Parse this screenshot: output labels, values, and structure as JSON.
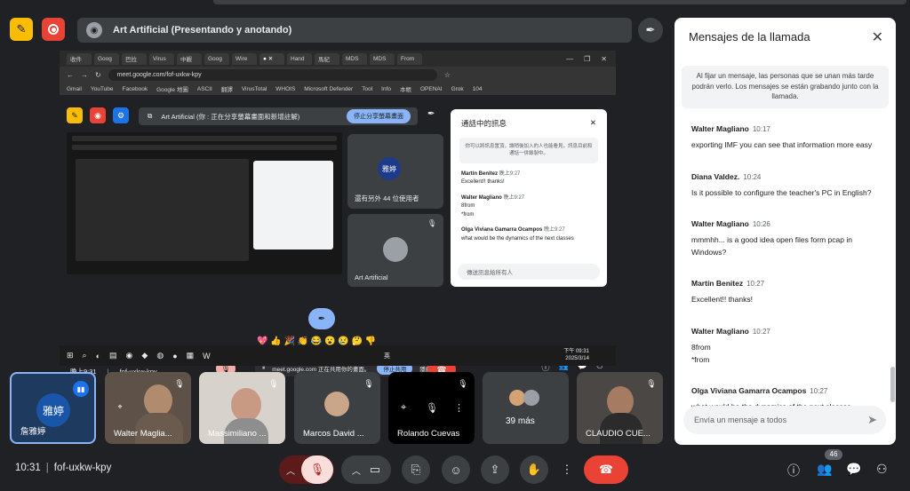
{
  "presenting": {
    "title": "Art Artificial (Presentando y anotando)"
  },
  "shared_screen": {
    "tabs": [
      "收件",
      "Goog",
      "巴拉",
      "Virus",
      "中觀",
      "Goog",
      "Wire",
      "",
      "Hand",
      "馬紀",
      "MDS",
      "MDS",
      "From"
    ],
    "url": "meet.google.com/fof-uxkw-kpy",
    "bookmarks": [
      "Gmail",
      "YouTube",
      "Facebook",
      "Google 地圖",
      "ASCII",
      "翻譯",
      "VirusTotal",
      "WHOIS",
      "Microsoft Defender",
      "Tool",
      "Info",
      "本帳",
      "OPENAI",
      "Grok",
      "104"
    ],
    "inner_present_title": "Art Artificial (你 : 正在分享螢幕畫面和新增註解)",
    "inner_stop_label": "停止分享螢幕畫面",
    "tile_avatar": "雅婷",
    "tile_others": "還有另外 44 位使用者",
    "tile_art": "Art Artificial",
    "inner_chat": {
      "title": "通話中的訊息",
      "note": "你可以將訊息置頂，讓稍後加入的人也能看見。訊息目前和通話一併錄製中。",
      "msgs": [
        {
          "who": "Martín Benitez",
          "when": "晚上9:27",
          "text": "Excellent!! thanks!"
        },
        {
          "who": "Walter Magliano",
          "when": "晚上9:27",
          "text": "8from\n*from"
        },
        {
          "who": "Olga Viviana Gamarra Ocampos",
          "when": "晚上9:27",
          "text": "what would be the dynamics of the next classes"
        }
      ],
      "placeholder": "傳送訊息給所有人"
    },
    "emojis": "💖 👍 🎉 👏 😂 😮 😢 🤔 👎",
    "footer_time": "晚上9:31",
    "footer_code": "fof-uxkw-kpy",
    "notice_text": "meet.google.com 正在共用你的畫面。",
    "notice_stop": "停止共用",
    "notice_hide": "隱藏",
    "people_badge": "46",
    "taskbar_time": "下午 09:31",
    "taskbar_date": "2025/3/14",
    "taskbar_lang": "英"
  },
  "chat": {
    "title": "Mensajes de la llamada",
    "pin_note": "Al fijar un mensaje, las personas que se unan más tarde podrán verlo. Los mensajes se están grabando junto con la llamada.",
    "messages": [
      {
        "who": "Walter Magliano",
        "when": "10:17",
        "text": "exporting IMF you can see that information more easy"
      },
      {
        "who": "Diana Valdez.",
        "when": "10:24",
        "text": "Is it possible to configure the teacher's PC in English?"
      },
      {
        "who": "Walter Magliano",
        "when": "10:26",
        "text": "mmmhh... is a good idea open files form pcap in Windows?"
      },
      {
        "who": "Martín Benitez",
        "when": "10:27",
        "text": "Excellent!! thanks!"
      },
      {
        "who": "Walter Magliano",
        "when": "10:27",
        "text": "8from"
      },
      {
        "who": "Olga Viviana Gamarra Ocampos",
        "when": "10:27",
        "text": "what would be the dynamics of the next classes"
      }
    ],
    "msg5_extra": "*from",
    "input_placeholder": "Envía un mensaje a todos"
  },
  "participants": [
    {
      "name": "詹雅婷",
      "avatar": "雅婷"
    },
    {
      "name": "Walter Maglia..."
    },
    {
      "name": "Massimiliano ..."
    },
    {
      "name": "Marcos David ..."
    },
    {
      "name": "Rolando Cuevas"
    },
    {
      "name": "39 más"
    },
    {
      "name": "CLAUDIO CUE..."
    }
  ],
  "footer": {
    "time": "10:31",
    "meeting_code": "fof-uxkw-kpy",
    "people_count": "46"
  },
  "colors": {
    "background": "#202124",
    "end_call": "#ea4335",
    "accent": "#8ab4f8",
    "recording": "#ea4335",
    "annotate": "#fbbc04"
  }
}
